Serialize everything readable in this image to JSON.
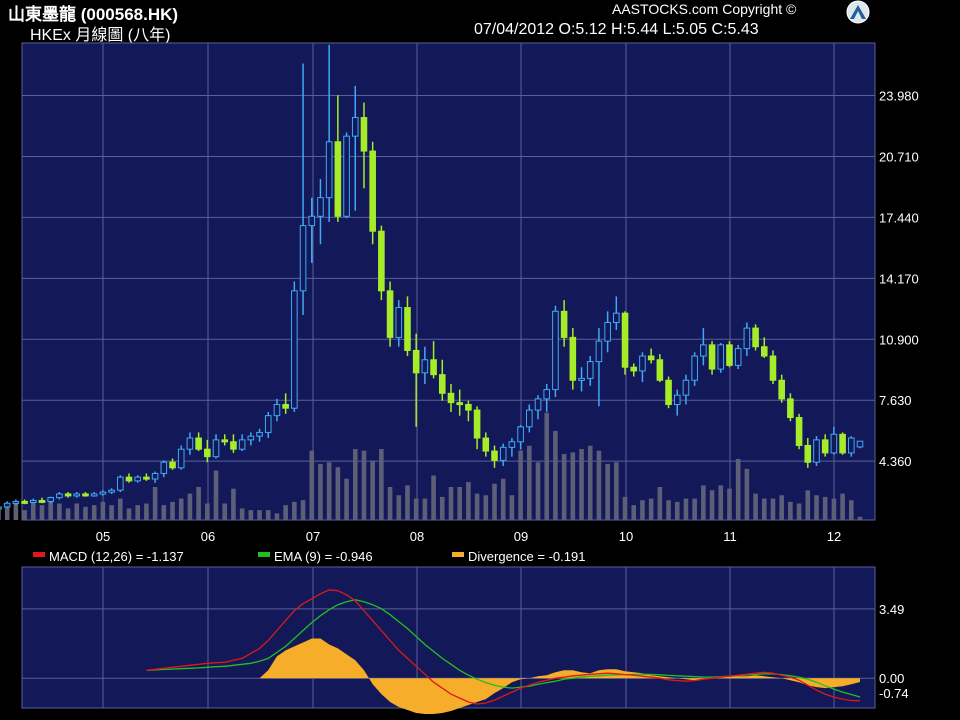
{
  "header": {
    "title": "山東墨龍 (000568.HK)",
    "subtitle": "HKEx 月線圖 (八年)",
    "copyright": "AASTOCKS.com Copyright ©",
    "ohlc": "07/04/2012   O:5.12  H:5.44  L:5.05  C:5.43"
  },
  "colors": {
    "panel_bg": "#131859",
    "grid": "#5a5f9a",
    "up_candle": "#3fa9f5",
    "down_candle": "#a6ec28",
    "volume": "#5d5e78",
    "macd": "#e01818",
    "ema": "#20c020",
    "divergence": "#f5ad2a"
  },
  "chart_data": [
    {
      "type": "candlestick",
      "title": "山東墨龍 (000568.HK)",
      "x_ticks": [
        "05",
        "06",
        "07",
        "08",
        "09",
        "10",
        "11",
        "12"
      ],
      "y_ticks": [
        4.36,
        7.63,
        10.9,
        14.17,
        17.44,
        20.71,
        23.98
      ],
      "y_tick_labels": [
        "4.360",
        "7.630",
        "10.900",
        "14.170",
        "17.440",
        "20.710",
        "23.980"
      ],
      "ylim": [
        1.2,
        26.8
      ],
      "grid": true,
      "candles_ohlc": [
        [
          1.8,
          1.9,
          1.7,
          1.85
        ],
        [
          1.85,
          1.95,
          1.75,
          1.8
        ],
        [
          1.8,
          1.9,
          1.7,
          1.78
        ],
        [
          1.75,
          1.95,
          1.65,
          1.85
        ],
        [
          1.85,
          2.0,
          1.78,
          1.9
        ],
        [
          1.9,
          2.2,
          1.85,
          2.1
        ],
        [
          2.1,
          2.3,
          2.0,
          2.2
        ],
        [
          2.2,
          2.3,
          2.05,
          2.15
        ],
        [
          2.15,
          2.35,
          2.1,
          2.25
        ],
        [
          2.25,
          2.4,
          2.1,
          2.2
        ],
        [
          2.2,
          2.45,
          2.1,
          2.4
        ],
        [
          2.4,
          2.7,
          2.3,
          2.6
        ],
        [
          2.6,
          2.7,
          2.4,
          2.5
        ],
        [
          2.5,
          2.7,
          2.4,
          2.6
        ],
        [
          2.6,
          2.7,
          2.45,
          2.55
        ],
        [
          2.55,
          2.7,
          2.45,
          2.6
        ],
        [
          2.6,
          2.8,
          2.5,
          2.7
        ],
        [
          2.7,
          2.9,
          2.6,
          2.8
        ],
        [
          2.8,
          3.6,
          2.7,
          3.5
        ],
        [
          3.5,
          3.7,
          3.2,
          3.3
        ],
        [
          3.3,
          3.6,
          3.2,
          3.5
        ],
        [
          3.5,
          3.7,
          3.3,
          3.4
        ],
        [
          3.4,
          3.8,
          3.2,
          3.7
        ],
        [
          3.7,
          4.4,
          3.5,
          4.3
        ],
        [
          4.3,
          4.5,
          3.9,
          4.0
        ],
        [
          4.0,
          5.2,
          3.9,
          5.0
        ],
        [
          5.0,
          5.9,
          4.7,
          5.6
        ],
        [
          5.6,
          5.9,
          4.9,
          5.0
        ],
        [
          5.0,
          5.5,
          4.3,
          4.6
        ],
        [
          4.6,
          5.8,
          4.5,
          5.5
        ],
        [
          5.5,
          5.8,
          5.2,
          5.4
        ],
        [
          5.4,
          5.8,
          4.8,
          5.0
        ],
        [
          5.0,
          5.8,
          4.9,
          5.5
        ],
        [
          5.5,
          5.9,
          5.2,
          5.7
        ],
        [
          5.7,
          6.1,
          5.4,
          5.9
        ],
        [
          5.9,
          7.0,
          5.6,
          6.8
        ],
        [
          6.8,
          7.7,
          6.5,
          7.4
        ],
        [
          7.4,
          8.0,
          6.9,
          7.2
        ],
        [
          7.2,
          14.0,
          7.0,
          13.5
        ],
        [
          13.5,
          25.7,
          12.2,
          17.0
        ],
        [
          17.0,
          18.5,
          15.0,
          17.5
        ],
        [
          17.5,
          19.5,
          16.0,
          18.5
        ],
        [
          18.5,
          26.7,
          17.2,
          21.5
        ],
        [
          21.5,
          24.0,
          17.2,
          17.5
        ],
        [
          17.5,
          22.0,
          17.4,
          21.8
        ],
        [
          21.8,
          24.5,
          17.8,
          22.8
        ],
        [
          22.8,
          23.6,
          19.0,
          21.0
        ],
        [
          21.0,
          21.5,
          16.0,
          16.7
        ],
        [
          16.7,
          17.0,
          13.0,
          13.5
        ],
        [
          13.5,
          14.0,
          10.5,
          11.0
        ],
        [
          11.0,
          13.0,
          10.5,
          12.6
        ],
        [
          12.6,
          13.2,
          10.0,
          10.3
        ],
        [
          10.3,
          11.2,
          6.2,
          9.1
        ],
        [
          9.1,
          10.5,
          8.5,
          9.8
        ],
        [
          9.8,
          10.8,
          8.8,
          9.0
        ],
        [
          9.0,
          9.8,
          7.6,
          8.0
        ],
        [
          8.0,
          8.5,
          7.0,
          7.5
        ],
        [
          7.5,
          8.2,
          6.8,
          7.4
        ],
        [
          7.4,
          7.6,
          6.5,
          7.1
        ],
        [
          7.1,
          7.3,
          5.0,
          5.6
        ],
        [
          5.6,
          5.9,
          4.6,
          4.9
        ],
        [
          4.9,
          5.2,
          4.0,
          4.4
        ],
        [
          4.4,
          5.3,
          4.1,
          5.1
        ],
        [
          5.1,
          5.6,
          4.6,
          5.4
        ],
        [
          5.4,
          6.3,
          5.0,
          6.2
        ],
        [
          6.2,
          7.4,
          5.9,
          7.1
        ],
        [
          7.1,
          7.9,
          6.6,
          7.7
        ],
        [
          7.7,
          8.5,
          7.0,
          8.2
        ],
        [
          8.2,
          12.7,
          7.8,
          12.4
        ],
        [
          12.4,
          13.0,
          10.5,
          11.0
        ],
        [
          11.0,
          11.5,
          8.2,
          8.7
        ],
        [
          8.7,
          9.4,
          8.1,
          8.8
        ],
        [
          8.8,
          10.0,
          8.4,
          9.7
        ],
        [
          9.7,
          11.5,
          7.3,
          10.8
        ],
        [
          10.8,
          12.4,
          10.2,
          11.8
        ],
        [
          11.8,
          13.2,
          11.4,
          12.3
        ],
        [
          12.3,
          12.4,
          9.0,
          9.4
        ],
        [
          9.4,
          9.6,
          8.9,
          9.2
        ],
        [
          9.2,
          10.2,
          8.6,
          10.0
        ],
        [
          10.0,
          10.4,
          9.6,
          9.8
        ],
        [
          9.8,
          10.1,
          8.6,
          8.7
        ],
        [
          8.7,
          8.9,
          7.2,
          7.4
        ],
        [
          7.4,
          8.2,
          6.8,
          7.9
        ],
        [
          7.9,
          9.0,
          7.4,
          8.7
        ],
        [
          8.7,
          10.2,
          8.4,
          10.0
        ],
        [
          10.0,
          11.5,
          9.5,
          10.6
        ],
        [
          10.6,
          10.8,
          9.0,
          9.3
        ],
        [
          9.3,
          10.7,
          9.1,
          10.6
        ],
        [
          10.6,
          10.8,
          9.4,
          9.5
        ],
        [
          9.5,
          10.6,
          9.3,
          10.4
        ],
        [
          10.4,
          11.8,
          10.0,
          11.5
        ],
        [
          11.5,
          11.7,
          10.3,
          10.5
        ],
        [
          10.5,
          11.0,
          9.9,
          10.0
        ],
        [
          10.0,
          10.3,
          8.5,
          8.7
        ],
        [
          8.7,
          9.0,
          7.5,
          7.7
        ],
        [
          7.7,
          8.0,
          6.5,
          6.7
        ],
        [
          6.7,
          6.9,
          5.0,
          5.2
        ],
        [
          5.2,
          5.6,
          4.0,
          4.3
        ],
        [
          4.3,
          5.7,
          4.1,
          5.5
        ],
        [
          5.5,
          5.8,
          4.6,
          4.8
        ],
        [
          4.8,
          6.2,
          4.7,
          5.8
        ],
        [
          5.8,
          5.9,
          4.7,
          4.8
        ],
        [
          4.8,
          5.7,
          4.6,
          5.6
        ],
        [
          5.12,
          5.44,
          5.05,
          5.43
        ]
      ],
      "volume_relative": [
        0.58,
        0.14,
        0.1,
        0.08,
        0.07,
        0.09,
        0.1,
        0.06,
        0.11,
        0.09,
        0.14,
        0.1,
        0.07,
        0.1,
        0.08,
        0.09,
        0.11,
        0.09,
        0.13,
        0.07,
        0.09,
        0.1,
        0.2,
        0.09,
        0.11,
        0.13,
        0.16,
        0.2,
        0.1,
        0.3,
        0.1,
        0.19,
        0.07,
        0.06,
        0.06,
        0.06,
        0.04,
        0.09,
        0.11,
        0.12,
        0.42,
        0.34,
        0.35,
        0.32,
        0.25,
        0.43,
        0.42,
        0.36,
        0.43,
        0.2,
        0.15,
        0.21,
        0.13,
        0.13,
        0.27,
        0.14,
        0.2,
        0.2,
        0.23,
        0.16,
        0.15,
        0.22,
        0.25,
        0.15,
        0.42,
        0.45,
        0.35,
        0.65,
        0.54,
        0.4,
        0.41,
        0.43,
        0.45,
        0.42,
        0.34,
        0.35,
        0.14,
        0.09,
        0.12,
        0.13,
        0.2,
        0.12,
        0.11,
        0.13,
        0.13,
        0.21,
        0.18,
        0.21,
        0.19,
        0.37,
        0.31,
        0.16,
        0.13,
        0.13,
        0.15,
        0.11,
        0.1,
        0.18,
        0.15,
        0.14,
        0.13,
        0.16,
        0.12,
        0.02
      ],
      "volume_color": "#5d5e78"
    },
    {
      "type": "line",
      "legend": [
        "MACD (12,26) = -1.137",
        "EMA (9) = -0.946",
        "Divergence = -0.191"
      ],
      "y_ticks": [
        3.49,
        0.0,
        -0.74
      ],
      "y_tick_labels": [
        "3.49",
        "0.00",
        "-0.74"
      ],
      "ylim": [
        -1.5,
        5.6
      ],
      "series": [
        {
          "name": "MACD (12,26)",
          "color": "#e01818",
          "values": [
            0.4,
            0.45,
            0.5,
            0.55,
            0.6,
            0.65,
            0.7,
            0.75,
            0.78,
            0.8,
            0.9,
            1.0,
            1.25,
            1.5,
            1.9,
            2.4,
            2.9,
            3.4,
            3.75,
            4.0,
            4.25,
            4.45,
            4.4,
            4.2,
            3.9,
            3.4,
            2.9,
            2.4,
            1.9,
            1.4,
            1.0,
            0.6,
            0.2,
            -0.2,
            -0.5,
            -0.8,
            -1.0,
            -1.2,
            -1.3,
            -1.25,
            -1.1,
            -0.9,
            -0.7,
            -0.5,
            -0.35,
            -0.2,
            -0.1,
            0.0,
            0.05,
            0.12,
            0.15,
            0.2,
            0.22,
            0.25,
            0.22,
            0.18,
            0.15,
            0.1,
            0.05,
            0.0,
            -0.08,
            -0.12,
            -0.15,
            -0.12,
            -0.05,
            0.0,
            0.05,
            0.1,
            0.15,
            0.2,
            0.25,
            0.3,
            0.25,
            0.15,
            0.05,
            -0.1,
            -0.35,
            -0.6,
            -0.8,
            -0.95,
            -1.05,
            -1.12,
            -1.137
          ]
        },
        {
          "name": "EMA (9)",
          "color": "#20c020",
          "values": [
            0.4,
            0.42,
            0.44,
            0.46,
            0.48,
            0.5,
            0.52,
            0.55,
            0.58,
            0.6,
            0.65,
            0.7,
            0.75,
            0.85,
            1.0,
            1.3,
            1.6,
            2.0,
            2.4,
            2.8,
            3.15,
            3.45,
            3.7,
            3.85,
            3.95,
            3.85,
            3.7,
            3.5,
            3.2,
            2.85,
            2.5,
            2.1,
            1.7,
            1.35,
            1.0,
            0.7,
            0.4,
            0.15,
            -0.05,
            -0.22,
            -0.35,
            -0.45,
            -0.5,
            -0.45,
            -0.4,
            -0.3,
            -0.22,
            -0.15,
            -0.05,
            0.0,
            0.05,
            0.1,
            0.12,
            0.15,
            0.17,
            0.18,
            0.19,
            0.2,
            0.19,
            0.17,
            0.14,
            0.12,
            0.1,
            0.08,
            0.06,
            0.05,
            0.07,
            0.1,
            0.13,
            0.16,
            0.19,
            0.22,
            0.22,
            0.18,
            0.12,
            0.05,
            -0.05,
            -0.2,
            -0.38,
            -0.55,
            -0.7,
            -0.82,
            -0.946
          ]
        },
        {
          "name": "Divergence",
          "color": "#f5ad2a",
          "values": [
            0.0,
            0.0,
            0.0,
            0.0,
            0.0,
            0.0,
            0.0,
            0.0,
            0.0,
            0.0,
            0.0,
            0.0,
            0.0,
            0.0,
            0.4,
            1.1,
            1.4,
            1.6,
            1.8,
            2.0,
            2.0,
            1.7,
            1.5,
            1.2,
            0.9,
            0.4,
            -0.3,
            -0.8,
            -1.2,
            -1.45,
            -1.6,
            -1.75,
            -1.8,
            -1.8,
            -1.75,
            -1.65,
            -1.5,
            -1.35,
            -1.2,
            -1.05,
            -0.75,
            -0.5,
            -0.2,
            -0.05,
            0.0,
            0.1,
            0.15,
            0.3,
            0.4,
            0.4,
            0.3,
            0.25,
            0.4,
            0.45,
            0.45,
            0.35,
            0.3,
            0.25,
            0.15,
            0.1,
            0.05,
            0.0,
            -0.05,
            -0.1,
            -0.05,
            0.0,
            0.05,
            0.1,
            0.1,
            0.1,
            0.15,
            0.1,
            0.05,
            0.0,
            -0.1,
            -0.2,
            -0.35,
            -0.45,
            -0.5,
            -0.45,
            -0.4,
            -0.3,
            -0.191
          ]
        }
      ]
    }
  ]
}
